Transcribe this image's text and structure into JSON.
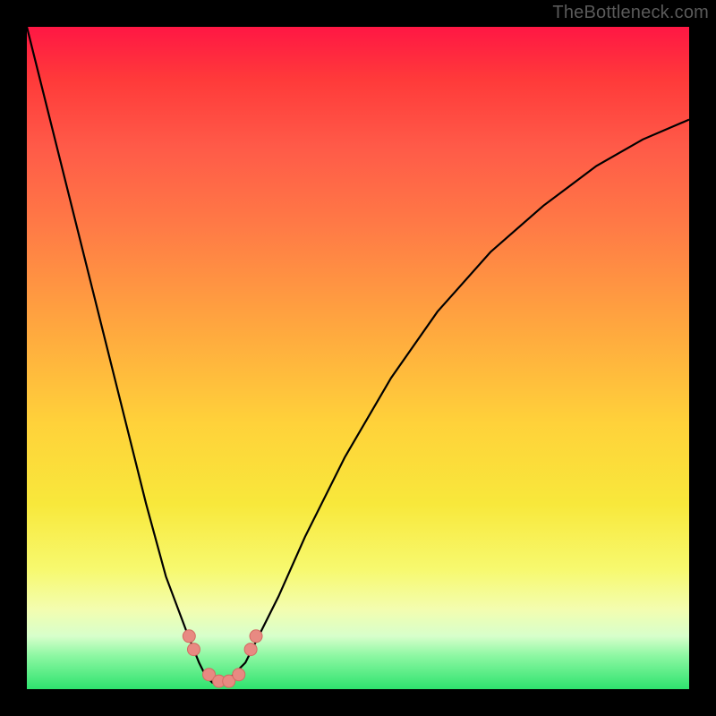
{
  "watermark": {
    "text": "TheBottleneck.com"
  },
  "chart_data": {
    "type": "line",
    "title": "",
    "xlabel": "",
    "ylabel": "",
    "xlim": [
      0,
      100
    ],
    "ylim": [
      0,
      100
    ],
    "grid": false,
    "series": [
      {
        "name": "bottleneck-curve",
        "x": [
          0,
          5,
          10,
          15,
          18,
          21,
          24,
          26,
          27,
          28,
          29,
          30,
          31,
          33,
          35,
          38,
          42,
          48,
          55,
          62,
          70,
          78,
          86,
          93,
          100
        ],
        "values": [
          100,
          80,
          60,
          40,
          28,
          17,
          9,
          4,
          2,
          1,
          1,
          1,
          2,
          4,
          8,
          14,
          23,
          35,
          47,
          57,
          66,
          73,
          79,
          83,
          86
        ]
      }
    ],
    "markers": [
      {
        "name": "left-dot-1",
        "x": 24.5,
        "y": 8.0
      },
      {
        "name": "left-dot-2",
        "x": 25.2,
        "y": 6.0
      },
      {
        "name": "bottom-dot-1",
        "x": 27.5,
        "y": 2.2
      },
      {
        "name": "bottom-dot-2",
        "x": 29.0,
        "y": 1.2
      },
      {
        "name": "bottom-dot-3",
        "x": 30.5,
        "y": 1.2
      },
      {
        "name": "bottom-dot-4",
        "x": 32.0,
        "y": 2.2
      },
      {
        "name": "right-dot-1",
        "x": 33.8,
        "y": 6.0
      },
      {
        "name": "right-dot-2",
        "x": 34.6,
        "y": 8.0
      }
    ],
    "marker_style": {
      "radius_px": 7,
      "fill": "#e88a82",
      "stroke": "#d46a62",
      "stroke_width": 1
    }
  }
}
